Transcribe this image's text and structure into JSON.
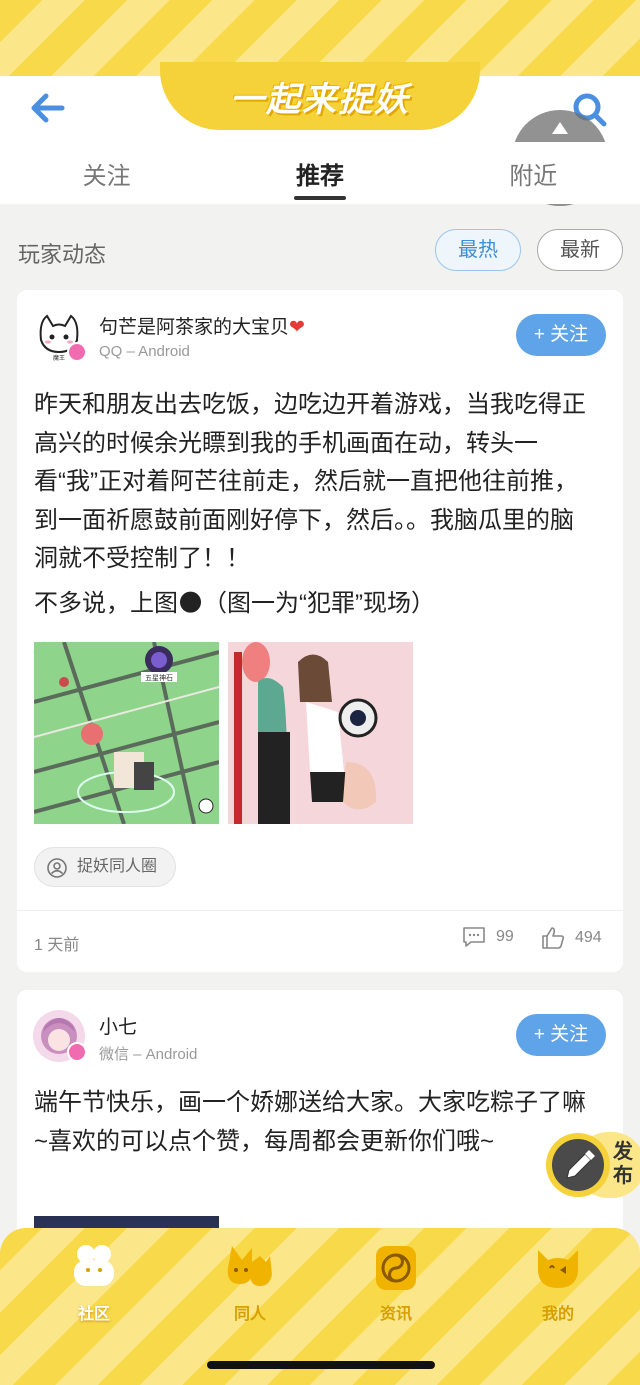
{
  "header": {
    "title": "一起来捉妖"
  },
  "tabs": [
    {
      "label": "关注"
    },
    {
      "label": "推荐"
    },
    {
      "label": "附近"
    }
  ],
  "section": {
    "title": "玩家动态",
    "filter_hot": "最热",
    "filter_new": "最新"
  },
  "posts": [
    {
      "user": "句芒是阿茶家的大宝贝",
      "source": "QQ – Android",
      "follow_label": "+ 关注",
      "text": "昨天和朋友出去吃饭，边吃边开着游戏，当我吃得正高兴的时候余光瞟到我的手机画面在动，转头一看“我”正对着阿芒往前走，然后就一直把他往前推，到一面祈愿鼓前面刚好停下，然后。。我脑瓜里的脑洞就不受控制了！！",
      "text2": "不多说，上图🌑（图一为“犯罪”现场）",
      "map_label": "五星神石",
      "tag": "捉妖同人圈",
      "time": "1 天前",
      "comments": "99",
      "likes": "494"
    },
    {
      "user": "小七",
      "source": "微信 – Android",
      "follow_label": "+ 关注",
      "text": "端午节快乐，画一个娇娜送给大家。大家吃粽子了嘛~喜欢的可以点个赞，每周都会更新你们哦~"
    }
  ],
  "publish_label": "发布",
  "bottom_nav": [
    {
      "label": "社区"
    },
    {
      "label": "同人"
    },
    {
      "label": "资讯"
    },
    {
      "label": "我的"
    }
  ],
  "colors": {
    "brand_yellow": "#f5d23a",
    "follow_blue": "#5fa4e8",
    "nav_label": "#d89f00"
  }
}
